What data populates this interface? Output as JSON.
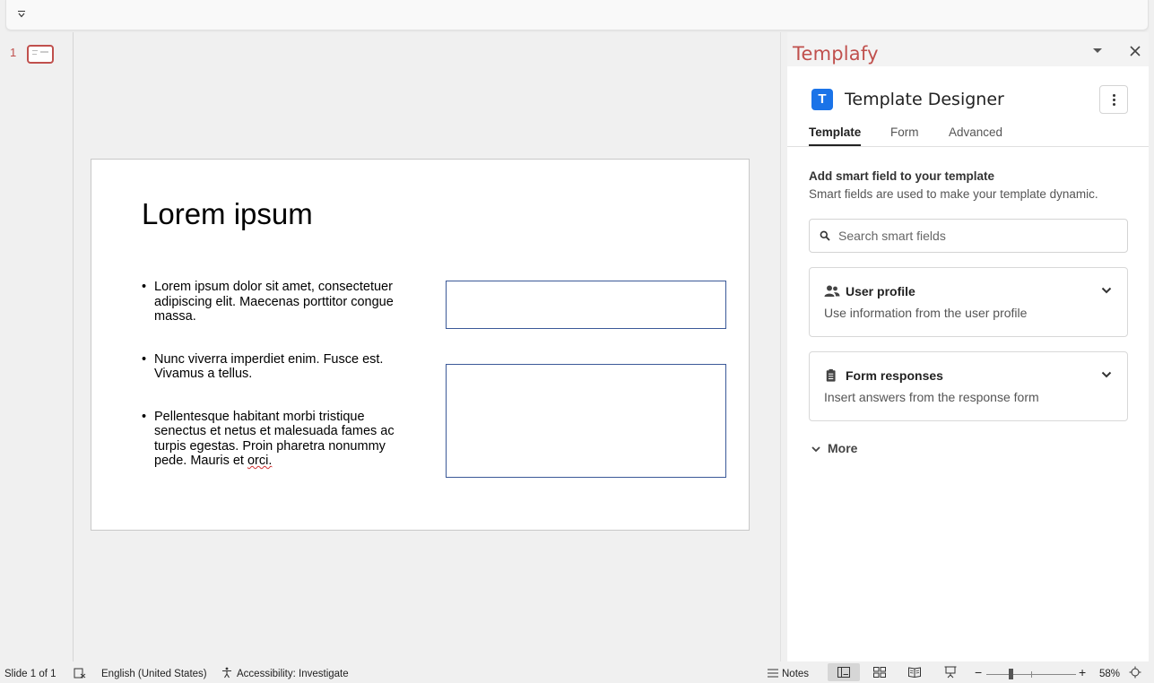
{
  "slide_panel": {
    "slide_number": "1"
  },
  "slide": {
    "title": "Lorem ipsum",
    "bullets": [
      "Lorem ipsum dolor sit amet, consectetuer adipiscing elit. Maecenas porttitor congue massa.",
      "Nunc viverra imperdiet enim. Fusce est. Vivamus a tellus.",
      "Pellentesque habitant morbi tristique senectus et netus et malesuada fames ac turpis egestas. Proin pharetra nonummy pede. Mauris et "
    ],
    "misspelled_word": "orci."
  },
  "task_pane": {
    "title": "Templafy",
    "app": {
      "logo_letter": "T",
      "name": "Template Designer"
    },
    "tabs": [
      {
        "label": "Template",
        "active": true
      },
      {
        "label": "Form",
        "active": false
      },
      {
        "label": "Advanced",
        "active": false
      }
    ],
    "section": {
      "title": "Add smart field to your template",
      "subtitle": "Smart fields are used to make your template dynamic."
    },
    "search": {
      "placeholder": "Search smart fields",
      "value": ""
    },
    "cards": [
      {
        "title": "User profile",
        "description": "Use information from the user profile",
        "icon": "users-icon"
      },
      {
        "title": "Form responses",
        "description": "Insert answers from the response form",
        "icon": "clipboard-icon"
      }
    ],
    "more_label": "More",
    "accent_color": "#c0504d",
    "brand_color": "#1a73e8"
  },
  "status_bar": {
    "slide_info": "Slide 1 of 1",
    "language": "English (United States)",
    "accessibility": "Accessibility: Investigate",
    "notes_label": "Notes",
    "zoom": "58%"
  }
}
